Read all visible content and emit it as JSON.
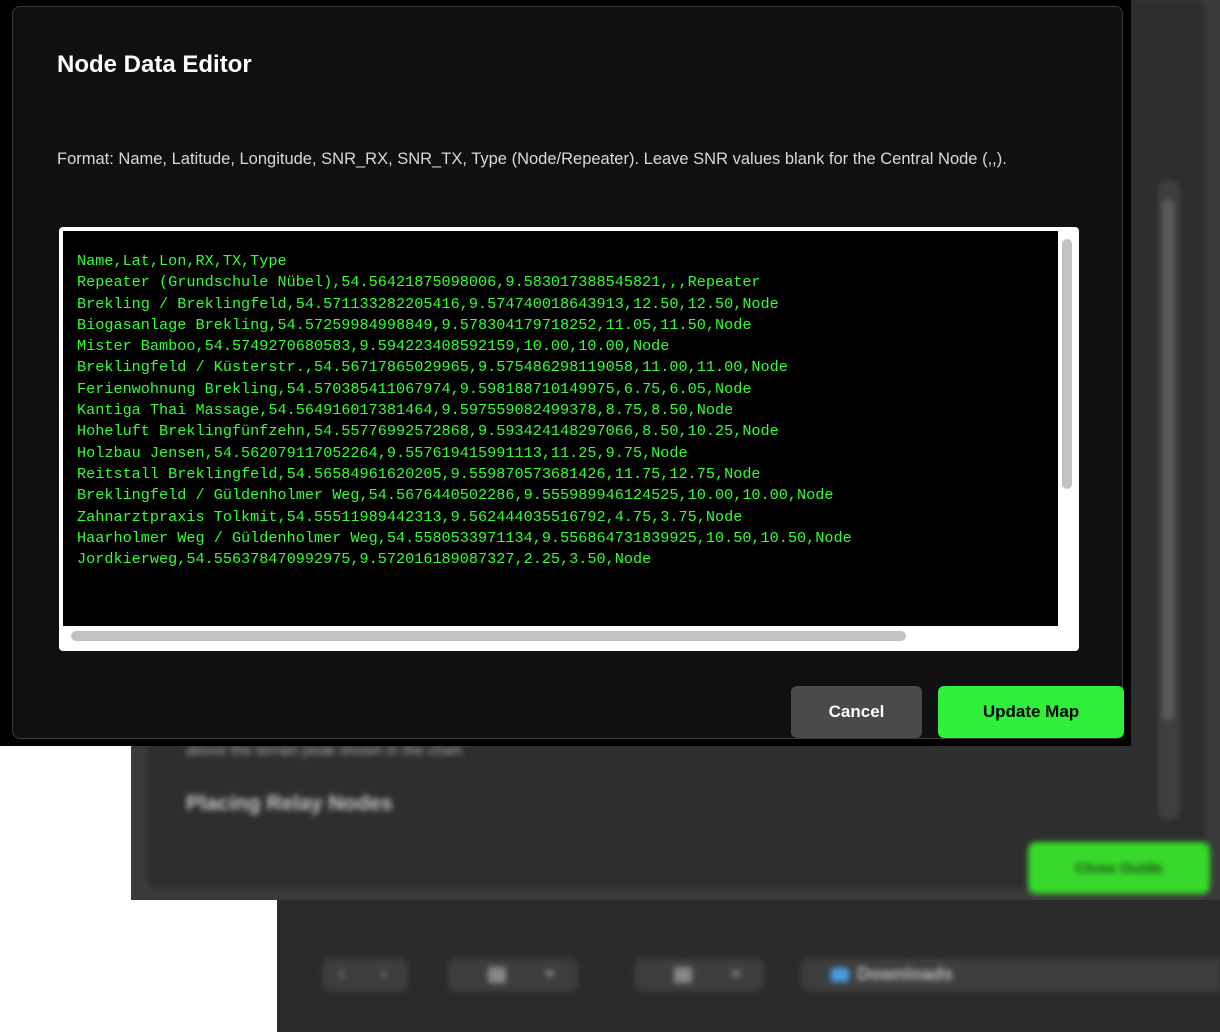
{
  "modal": {
    "title": "Node Data Editor",
    "description": "Format: Name, Latitude, Longitude, SNR_RX, SNR_TX, Type (Node/Repeater). Leave SNR values blank for the Central Node (,,).",
    "editor_lines": [
      "Name,Lat,Lon,RX,TX,Type",
      "Repeater (Grundschule Nübel),54.56421875098006,9.583017388545821,,,Repeater",
      "Brekling / Breklingfeld,54.571133282205416,9.574740018643913,12.50,12.50,Node",
      "Biogasanlage Brekling,54.57259984998849,9.578304179718252,11.05,11.50,Node",
      "Mister Bamboo,54.5749270680583,9.594223408592159,10.00,10.00,Node",
      "Breklingfeld / Küsterstr.,54.56717865029965,9.575486298119058,11.00,11.00,Node",
      "Ferienwohnung Brekling,54.570385411067974,9.598188710149975,6.75,6.05,Node",
      "Kantiga Thai Massage,54.564916017381464,9.597559082499378,8.75,8.50,Node",
      "Hoheluft Breklingfünfzehn,54.55776992572868,9.593424148297066,8.50,10.25,Node",
      "Holzbau Jensen,54.562079117052264,9.557619415991113,11.25,9.75,Node",
      "Reitstall Breklingfeld,54.56584961620205,9.559870573681426,11.75,12.75,Node",
      "Breklingfeld / Güldenholmer Weg,54.5676440502286,9.555989946124525,10.00,10.00,Node",
      "Zahnarztpraxis Tolkmit,54.55511989442313,9.562444035516792,4.75,3.75,Node",
      "Haarholmer Weg / Güldenholmer Weg,54.5580533971134,9.556864731839925,10.50,10.50,Node",
      "Jordkierweg,54.556378470992975,9.572016189087327,2.25,3.50,Node"
    ],
    "cancel_label": "Cancel",
    "update_label": "Update Map",
    "accent_color": "#2ef03a",
    "code_color": "#33ff33"
  },
  "background": {
    "close_button_label": "Close Guide",
    "section_heading": "Placing Relay Nodes",
    "caption_text": "above the terrain peak shown in the chart.",
    "finder_path_label": "Downloads"
  }
}
